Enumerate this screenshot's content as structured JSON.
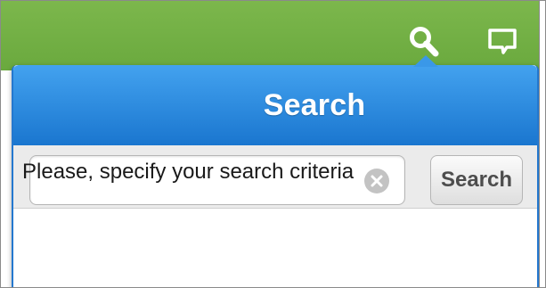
{
  "popover": {
    "title": "Search",
    "search_button_label": "Search",
    "input_value": "",
    "input_placeholder": "",
    "message": "Please, specify your search criteria"
  },
  "topbar": {
    "icons": [
      "search-icon",
      "chat-icon"
    ]
  },
  "colors": {
    "topbar_green": "#74b244",
    "header_blue": "#2b88dc",
    "border_blue": "#2478cf",
    "row_gray": "#ebebeb"
  }
}
